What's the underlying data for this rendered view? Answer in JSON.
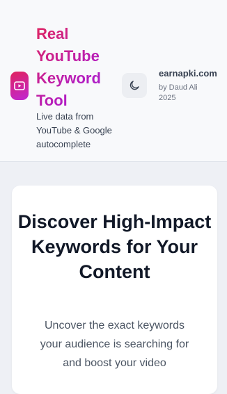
{
  "header": {
    "title": "Real YouTube Keyword Tool",
    "subtitle": "Live data from YouTube & Google autocomplete",
    "brand_name": "earnapki.com",
    "brand_by": "by Daud Ali 2025"
  },
  "hero": {
    "title": "Discover High-Impact Keywords for Your Content",
    "subtitle": "Uncover the exact keywords your audience is searching for and boost your video"
  },
  "icons": {
    "logo": "youtube-play-icon",
    "theme": "moon-icon"
  },
  "colors": {
    "accent_start": "#e0245e",
    "accent_end": "#9b1bd6"
  }
}
